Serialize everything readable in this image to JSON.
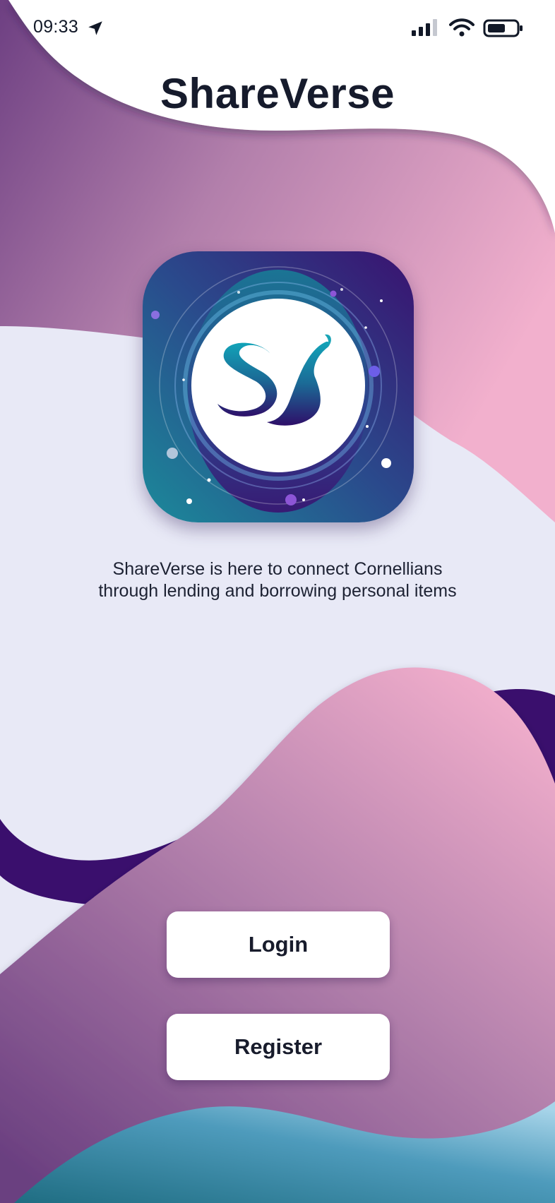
{
  "status_bar": {
    "time": "09:33",
    "location_icon": "navigation-arrow-icon",
    "signal_icon": "cellular-signal-icon",
    "wifi_icon": "wifi-icon",
    "battery_icon": "battery-icon"
  },
  "header": {
    "title": "ShareVerse"
  },
  "logo": {
    "monogram": "SS"
  },
  "tagline": {
    "line1": "ShareVerse is here to connect Cornellians",
    "line2": "through lending and borrowing personal items"
  },
  "actions": {
    "login_label": "Login",
    "register_label": "Register"
  },
  "colors": {
    "brand_purple": "#3a0f6d",
    "brand_pink": "#f1aecb",
    "brand_mauve": "#7a4a86",
    "brand_teal": "#1d7f93",
    "panel_lavender": "#e8e9f6",
    "text_dark": "#161b2c"
  }
}
